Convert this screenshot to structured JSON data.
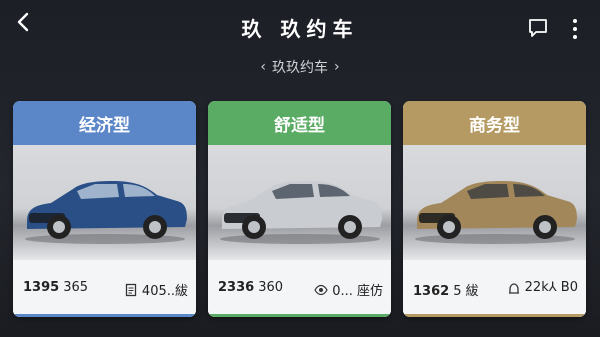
{
  "header": {
    "title": "玖 玖约车",
    "subtitle": "玖玖约车",
    "back_icon": "chevron-left-icon",
    "chat_icon": "chat-bubble-icon",
    "more_icon": "more-vertical-icon"
  },
  "cards": [
    {
      "category": "经济型",
      "header_color": "#5b87c9",
      "car_color": "#2a4f86",
      "price_bold": "1395",
      "price_rest": "365",
      "spec_icon": "document-icon",
      "spec_text": "405..紱"
    },
    {
      "category": "舒适型",
      "header_color": "#5aab63",
      "car_color": "#c9ccd0",
      "price_bold": "2336",
      "price_rest": "360",
      "spec_icon": "eye-icon",
      "spec_text": "0... 座仿"
    },
    {
      "category": "商务型",
      "header_color": "#b59b63",
      "car_color": "#a2875a",
      "price_bold": "1362",
      "price_rest": "5 紱",
      "spec_icon": "seat-icon",
      "spec_text": "22k⅄ B0"
    }
  ]
}
